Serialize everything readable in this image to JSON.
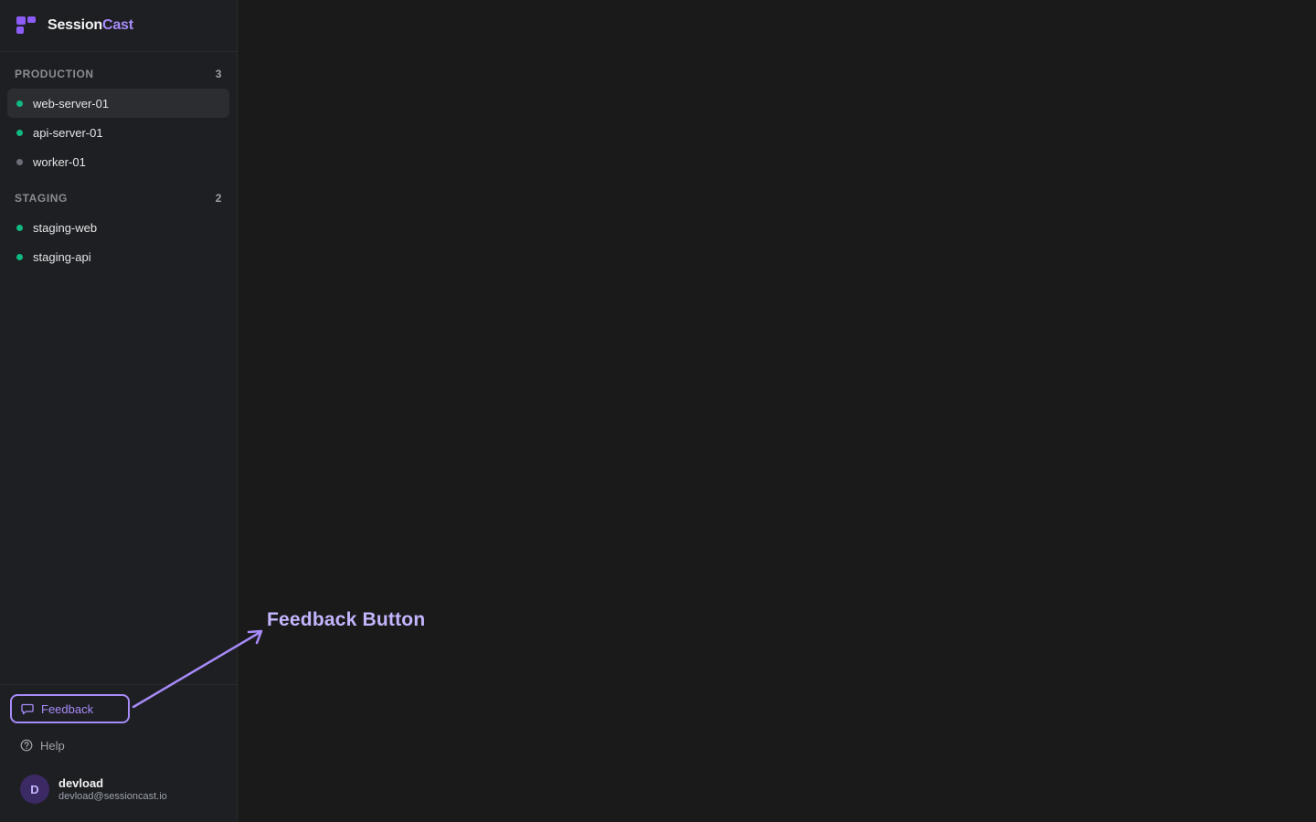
{
  "brand": {
    "name_part1": "Session",
    "name_part2": "Cast",
    "logo_icon": "grid-logo-icon"
  },
  "groups": [
    {
      "title": "PRODUCTION",
      "count": "3",
      "items": [
        {
          "label": "web-server-01",
          "status": "online",
          "active": true
        },
        {
          "label": "api-server-01",
          "status": "online",
          "active": false
        },
        {
          "label": "worker-01",
          "status": "offline",
          "active": false
        }
      ]
    },
    {
      "title": "STAGING",
      "count": "2",
      "items": [
        {
          "label": "staging-web",
          "status": "online",
          "active": false
        },
        {
          "label": "staging-api",
          "status": "online",
          "active": false
        }
      ]
    }
  ],
  "footer": {
    "feedback_label": "Feedback",
    "feedback_icon": "message-square-icon",
    "help_label": "Help",
    "help_icon": "help-circle-icon"
  },
  "user": {
    "initial": "D",
    "name": "devload",
    "email": "devload@sessioncast.io"
  },
  "annotation": {
    "label": "Feedback Button"
  },
  "colors": {
    "accent": "#a78bfa",
    "brand": "#8b5cf6",
    "online": "#10b981",
    "offline": "#6b6e76",
    "sidebar_bg": "#1e1f22",
    "main_bg": "#1a1a1b"
  }
}
